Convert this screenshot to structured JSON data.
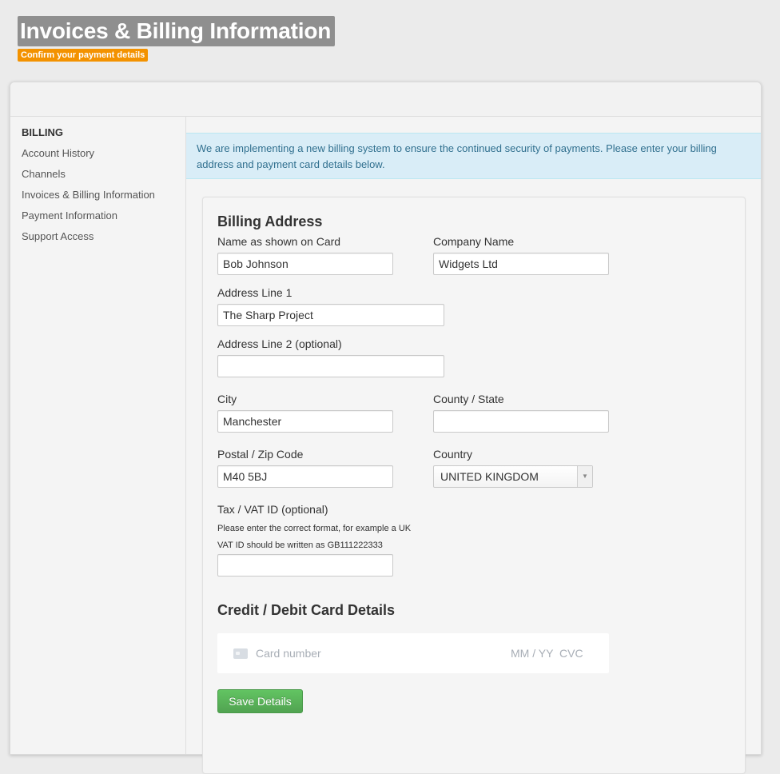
{
  "header": {
    "title": "Invoices & Billing Information",
    "subtitle": "Confirm your payment details"
  },
  "sidebar": {
    "heading": "BILLING",
    "items": [
      {
        "label": "Account History"
      },
      {
        "label": "Channels"
      },
      {
        "label": "Invoices & Billing Information"
      },
      {
        "label": "Payment Information"
      },
      {
        "label": "Support Access"
      }
    ]
  },
  "alert": {
    "text": "We are implementing a new billing system to ensure the continued security of payments. Please enter your billing address and payment card details below."
  },
  "billing": {
    "title": "Billing Address",
    "name_label": "Name as shown on Card",
    "name_value": "Bob Johnson",
    "company_label": "Company Name",
    "company_value": "Widgets Ltd",
    "address1_label": "Address Line 1",
    "address1_value": "The Sharp Project",
    "address2_label": "Address Line 2 (optional)",
    "address2_value": "",
    "city_label": "City",
    "city_value": "Manchester",
    "state_label": "County / State",
    "state_value": "",
    "postal_label": "Postal / Zip Code",
    "postal_value": "M40 5BJ",
    "country_label": "Country",
    "country_value": "UNITED KINGDOM",
    "vat_label": "Tax / VAT ID (optional)",
    "vat_help": "Please enter the correct format, for example a UK VAT ID should be written as GB111222333",
    "vat_value": ""
  },
  "card": {
    "title": "Credit / Debit Card Details",
    "number_placeholder": "Card number",
    "expiry_placeholder": "MM / YY",
    "cvc_placeholder": "CVC"
  },
  "actions": {
    "save_label": "Save Details"
  }
}
